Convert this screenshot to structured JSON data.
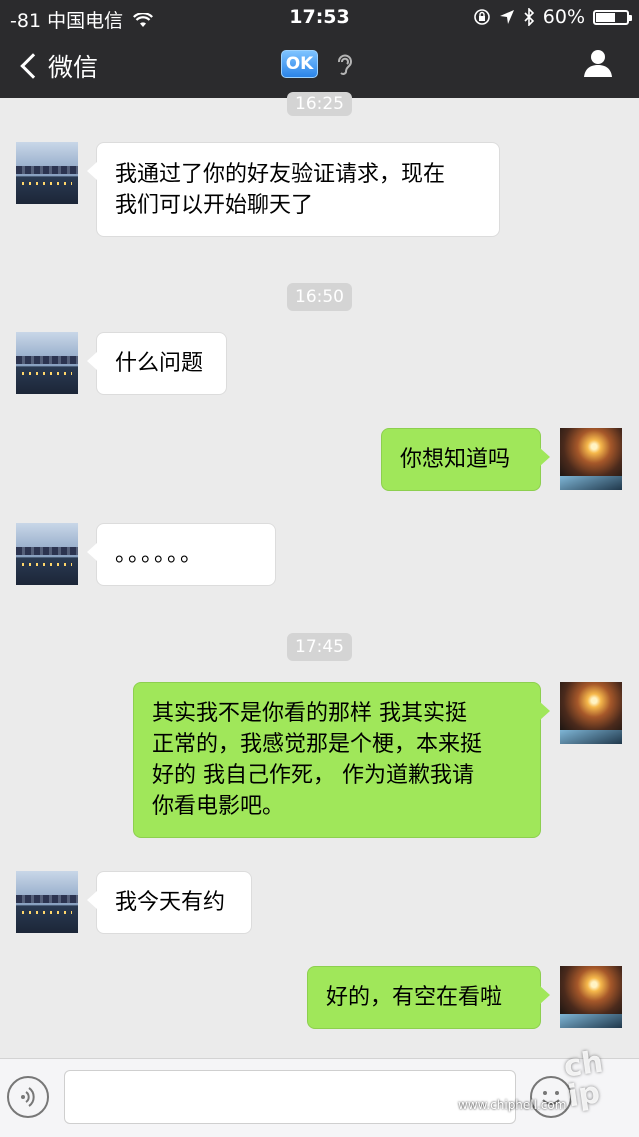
{
  "status_bar": {
    "carrier": "-81 中国电信",
    "time": "17:53",
    "battery": "60%"
  },
  "nav": {
    "back_label": "微信",
    "ok_badge": "OK"
  },
  "timestamps": [
    "16:25",
    "16:50",
    "17:45"
  ],
  "messages": [
    {
      "side": "in",
      "lines": [
        "我通过了你的好友验证请求，现在",
        "我们可以开始聊天了"
      ]
    },
    {
      "side": "in",
      "lines": [
        "什么问题"
      ]
    },
    {
      "side": "out",
      "lines": [
        "你想知道吗"
      ]
    },
    {
      "side": "in",
      "lines": [
        "。。。。。。"
      ]
    },
    {
      "side": "out",
      "lines": [
        "其实我不是你看的那样 我其实挺",
        "正常的，我感觉那是个梗，本来挺",
        "好的 我自己作死， 作为道歉我请",
        "你看电影吧。"
      ]
    },
    {
      "side": "in",
      "lines": [
        "我今天有约"
      ]
    },
    {
      "side": "out",
      "lines": [
        "好的，有空在看啦"
      ]
    }
  ],
  "input": {
    "value": ""
  },
  "watermark": {
    "logo": "chiphell",
    "url": "www.chiphell.com"
  },
  "colors": {
    "nav_bg": "#2b2b2d",
    "chat_bg": "#ebebeb",
    "out_bubble": "#a0e75a",
    "in_bubble": "#ffffff"
  }
}
